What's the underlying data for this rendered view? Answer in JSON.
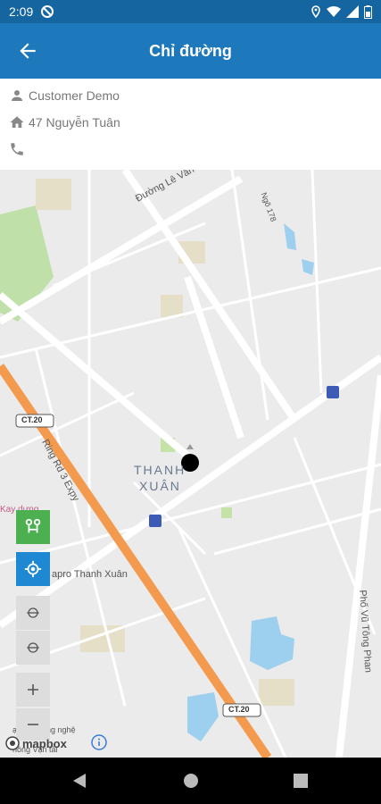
{
  "status": {
    "time": "2:09"
  },
  "appbar": {
    "title": "Chỉ đường"
  },
  "info": {
    "customer": "Customer Demo",
    "address": "47 Nguyễn Tuân",
    "phone": ""
  },
  "map": {
    "streets": [
      "Đường Lê Văn Lương",
      "Ngõ 178",
      "Ring Rd 3 Expy",
      "Phố Vũ Tông Phan"
    ],
    "district": [
      "THANH",
      "XUÂN"
    ],
    "road_shields": [
      "CT.20",
      "CT.20"
    ],
    "pois": [
      "Kay dựng",
      "apro Thanh Xuân",
      "ại học Công nghệ",
      "hông Vận tải"
    ],
    "attribution": "mapbox"
  },
  "colors": {
    "statusbar": "#1565a0",
    "appbar": "#1e78bc",
    "green_btn": "#4caf50",
    "locate_btn": "#1e88d2",
    "highway": "#f39a4f"
  }
}
